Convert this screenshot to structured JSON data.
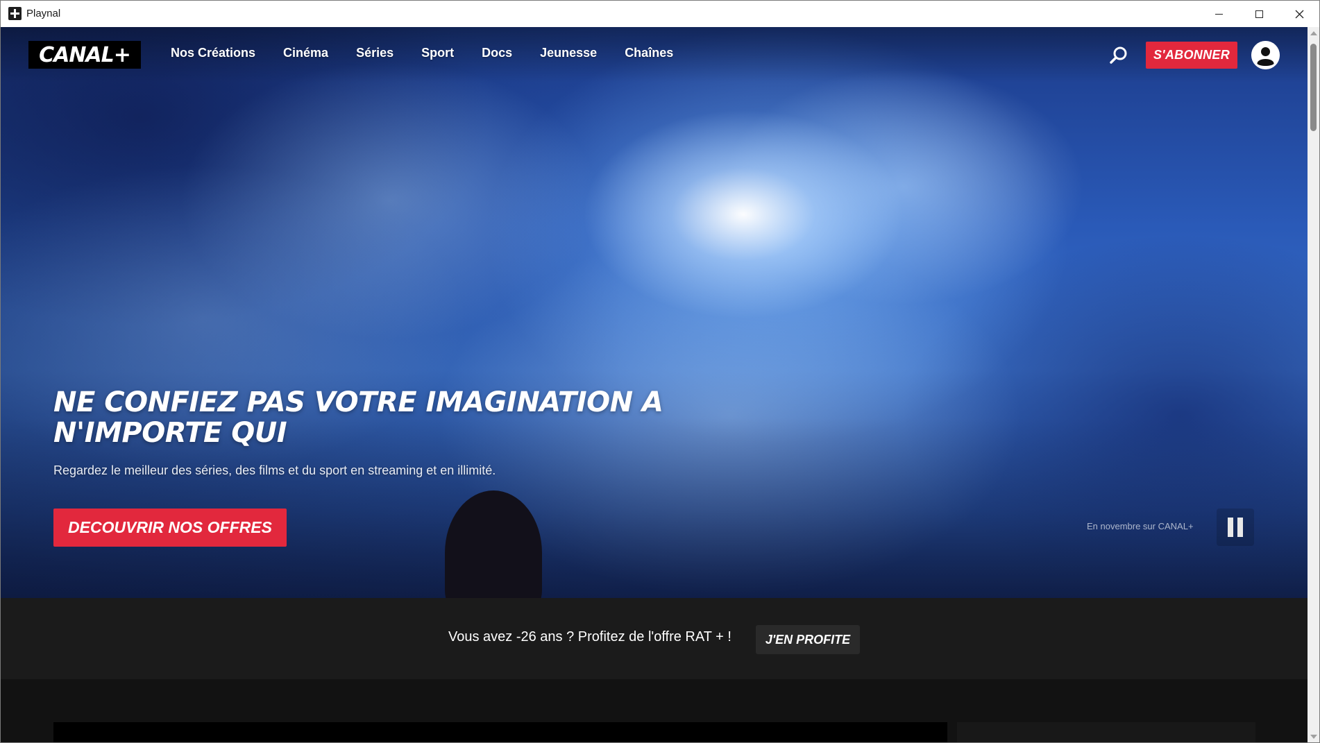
{
  "window": {
    "title": "Playnal"
  },
  "header": {
    "logo_text": "CANAL+",
    "nav": [
      {
        "label": "Nos Créations"
      },
      {
        "label": "Cinéma"
      },
      {
        "label": "Séries"
      },
      {
        "label": "Sport"
      },
      {
        "label": "Docs"
      },
      {
        "label": "Jeunesse"
      },
      {
        "label": "Chaînes"
      }
    ],
    "subscribe_label": "S'ABONNER",
    "icons": {
      "search": "search-icon",
      "account": "user-icon"
    }
  },
  "hero": {
    "title_line1": "NE CONFIEZ PAS VOTRE IMAGINATION A",
    "title_line2": "N'IMPORTE QUI",
    "subtitle": "Regardez le meilleur des séries, des films et du sport en streaming et en illimité.",
    "cta_label": "DECOUVRIR NOS OFFRES",
    "caption": "En novembre sur CANAL+",
    "pause_icon": "pause-icon"
  },
  "promo": {
    "text": "Vous avez -26 ans ? Profitez de l'offre RAT + !",
    "button_label": "J'EN PROFITE"
  },
  "colors": {
    "accent_red": "#e2283d",
    "band_bg": "#1b1b1b",
    "page_bg": "#141414"
  }
}
